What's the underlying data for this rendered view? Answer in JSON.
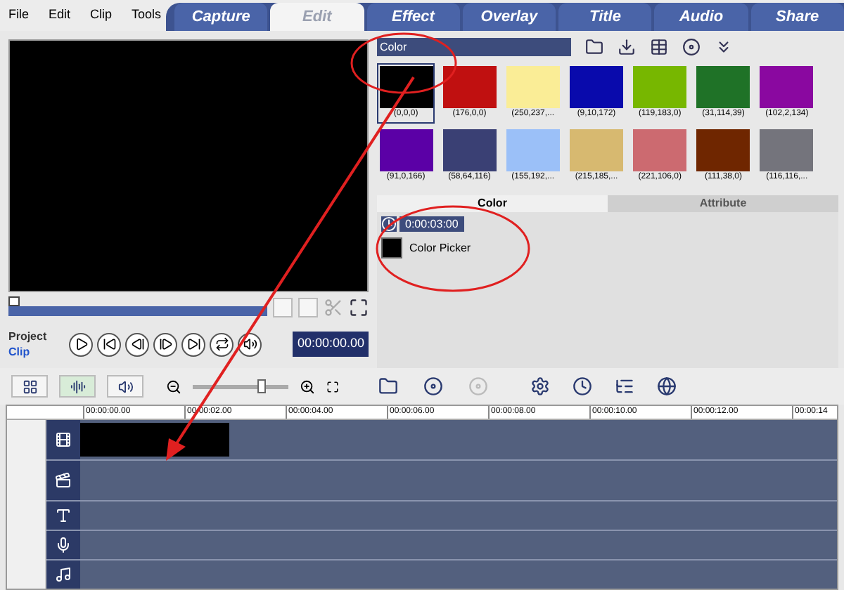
{
  "menu": [
    "File",
    "Edit",
    "Clip",
    "Tools"
  ],
  "tabs": [
    {
      "label": "Capture",
      "selected": false
    },
    {
      "label": "Edit",
      "selected": true
    },
    {
      "label": "Effect",
      "selected": false
    },
    {
      "label": "Overlay",
      "selected": false
    },
    {
      "label": "Title",
      "selected": false
    },
    {
      "label": "Audio",
      "selected": false
    },
    {
      "label": "Share",
      "selected": false
    }
  ],
  "player": {
    "modes": [
      {
        "label": "Project",
        "selected": false
      },
      {
        "label": "Clip",
        "selected": true
      }
    ],
    "timecode": "00:00:00.00"
  },
  "library": {
    "category": "Color",
    "swatches": [
      {
        "label": "(0,0,0)",
        "color": "#000000",
        "selected": true
      },
      {
        "label": "(176,0,0)",
        "color": "#c01010",
        "selected": false
      },
      {
        "label": "(250,237,...",
        "color": "#faed96",
        "selected": false
      },
      {
        "label": "(9,10,172)",
        "color": "#090aac",
        "selected": false
      },
      {
        "label": "(119,183,0)",
        "color": "#77b700",
        "selected": false
      },
      {
        "label": "(31,114,39)",
        "color": "#1f7227",
        "selected": false
      },
      {
        "label": "(102,2,134)",
        "color": "#8a08a0",
        "selected": false
      },
      {
        "label": "(91,0,166)",
        "color": "#5b00a6",
        "selected": false
      },
      {
        "label": "(58,64,116)",
        "color": "#3a4074",
        "selected": false
      },
      {
        "label": "(155,192,...",
        "color": "#9bc0f8",
        "selected": false
      },
      {
        "label": "(215,185,...",
        "color": "#d7b970",
        "selected": false
      },
      {
        "label": "(221,106,0)",
        "color": "#cc6a70",
        "selected": false
      },
      {
        "label": "(111,38,0)",
        "color": "#6f2600",
        "selected": false
      },
      {
        "label": "(116,116,...",
        "color": "#74747c",
        "selected": false
      }
    ]
  },
  "options": {
    "tabs": [
      {
        "label": "Color",
        "selected": true
      },
      {
        "label": "Attribute",
        "selected": false
      }
    ],
    "duration": "0:00:03:00",
    "picker_label": "Color Picker"
  },
  "view_modes": [
    {
      "kind": "storyboard",
      "selected": false
    },
    {
      "kind": "timeline",
      "selected": true
    },
    {
      "kind": "audio",
      "selected": false
    }
  ],
  "zoom": {
    "level": 0.72
  },
  "ruler": [
    "00:00:00.00",
    "00:00:02.00",
    "00:00:04.00",
    "00:00:06.00",
    "00:00:08.00",
    "00:00:10.00",
    "00:00:12.00",
    "00:00:14"
  ],
  "tracks": [
    {
      "kind": "video",
      "has_clip": true
    },
    {
      "kind": "overlay",
      "has_clip": false
    },
    {
      "kind": "title",
      "has_clip": false
    },
    {
      "kind": "voice",
      "has_clip": false
    },
    {
      "kind": "music",
      "has_clip": false
    }
  ]
}
